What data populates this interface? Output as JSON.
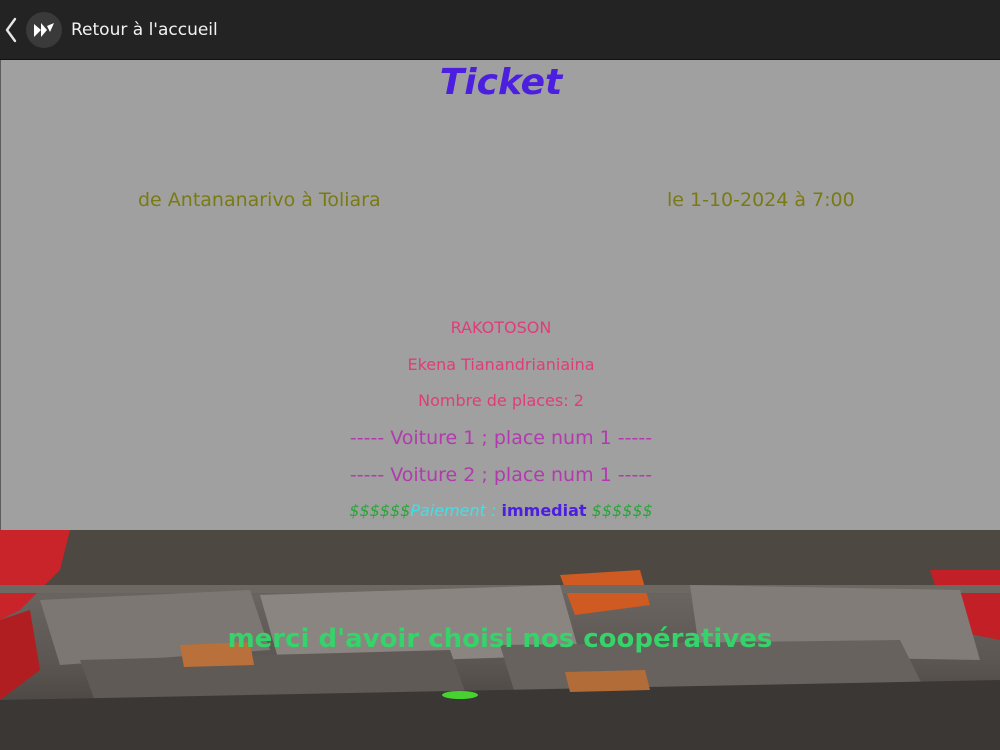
{
  "header": {
    "back_label": "Retour à l'accueil",
    "icons": [
      "chevron-left-icon",
      "app-logo-icon"
    ]
  },
  "ticket": {
    "title": "Ticket",
    "route": "de Antananarivo à Toliara",
    "datetime": "le 1-10-2024 à 7:00",
    "last_name": "RAKOTOSON",
    "first_name": "Ekena Tianandrianiaina",
    "places": "Nombre de places: 2",
    "seats": [
      "----- Voiture 1 ; place num 1 -----",
      "----- Voiture 2 ; place num 1 -----"
    ],
    "payment": {
      "prefix": "$$$$$$",
      "label": "Paiement : ",
      "value": "immediat",
      "suffix": " $$$$$$"
    }
  },
  "footer": {
    "thanks": "merci d'avoir choisi nos coopératives"
  },
  "colors": {
    "title": "#4b1ee0",
    "route": "#7a7a14",
    "names": "#e13c78",
    "seats": "#b23aae",
    "dollars": "#2aa43a",
    "payment_label": "#3fe0e8",
    "thanks": "#35d36a",
    "ticket_background": "#a0a0a0",
    "topbar_background": "#232323"
  }
}
